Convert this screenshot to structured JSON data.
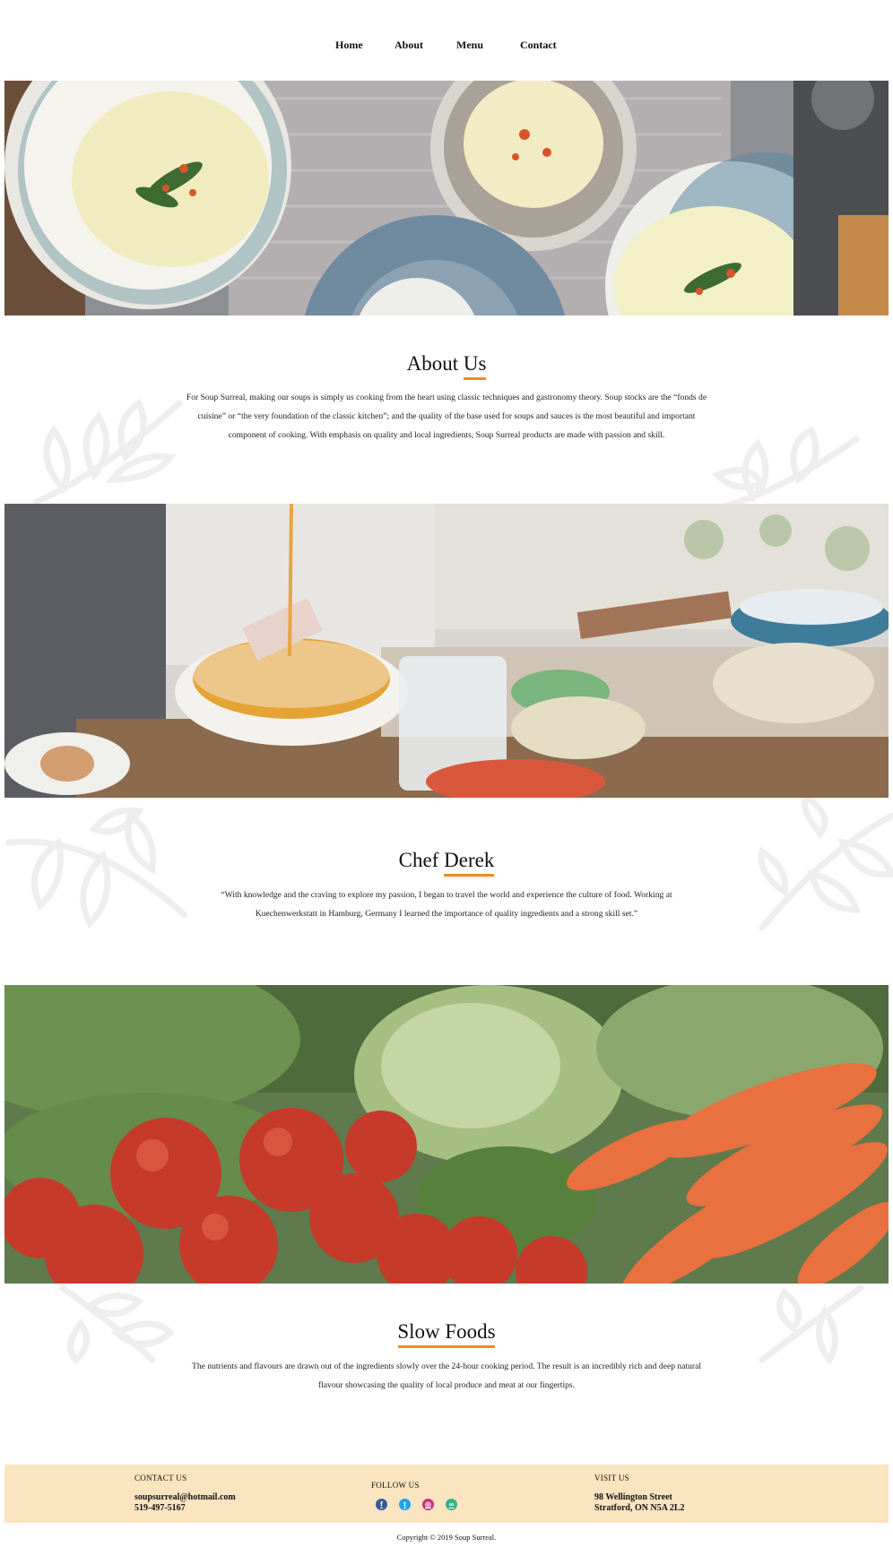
{
  "nav": {
    "items": [
      {
        "label": "Home"
      },
      {
        "label": "About"
      },
      {
        "label": "Menu"
      },
      {
        "label": "Contact"
      }
    ]
  },
  "about": {
    "title": "About Us",
    "text": "For Soup Surreal, making our soups is simply us cooking from the heart using classic techniques and gastronomy theory. Soup stocks are the “fonds de cuisine” or “the very foundation of the classic kitchen”; and the quality of the base used for soups and sauces is the most beautiful and important component of cooking. With emphasis on quality and local ingredients, Soup Surreal products are made with passion and skill."
  },
  "chef": {
    "title": "Chef Derek",
    "text": "“With knowledge and the craving to explore my passion, I began to travel the world and experience the culture of food. Working at Kuechenwerkstatt in Hamburg, Germany I learned the importance of quality ingredients and a strong skill set.”"
  },
  "slow": {
    "title": "Slow Foods",
    "text": "The nutrients and flavours are drawn out of the ingredients slowly over the 24-hour cooking period. The result is an incredibly rich and deep natural flavour showcasing the quality of local produce and meat at our fingertips."
  },
  "footer": {
    "contact": {
      "label": "CONTACT US",
      "email": "soupsurreal@hotmail.com",
      "phone": "519-497-5167"
    },
    "follow": {
      "label": "FOLLOW US",
      "icons": [
        "facebook-icon",
        "twitter-icon",
        "instagram-icon",
        "tripadvisor-icon"
      ]
    },
    "visit": {
      "label": "VISIT US",
      "street": "98 Wellington Street",
      "city": "Stratford, ON N5A 2L2"
    },
    "copyright": "Copyright © 2019 Soup Surreal."
  },
  "colors": {
    "accent": "#f28a1c",
    "footer_bg": "#fae5c0",
    "text": "#111111"
  }
}
